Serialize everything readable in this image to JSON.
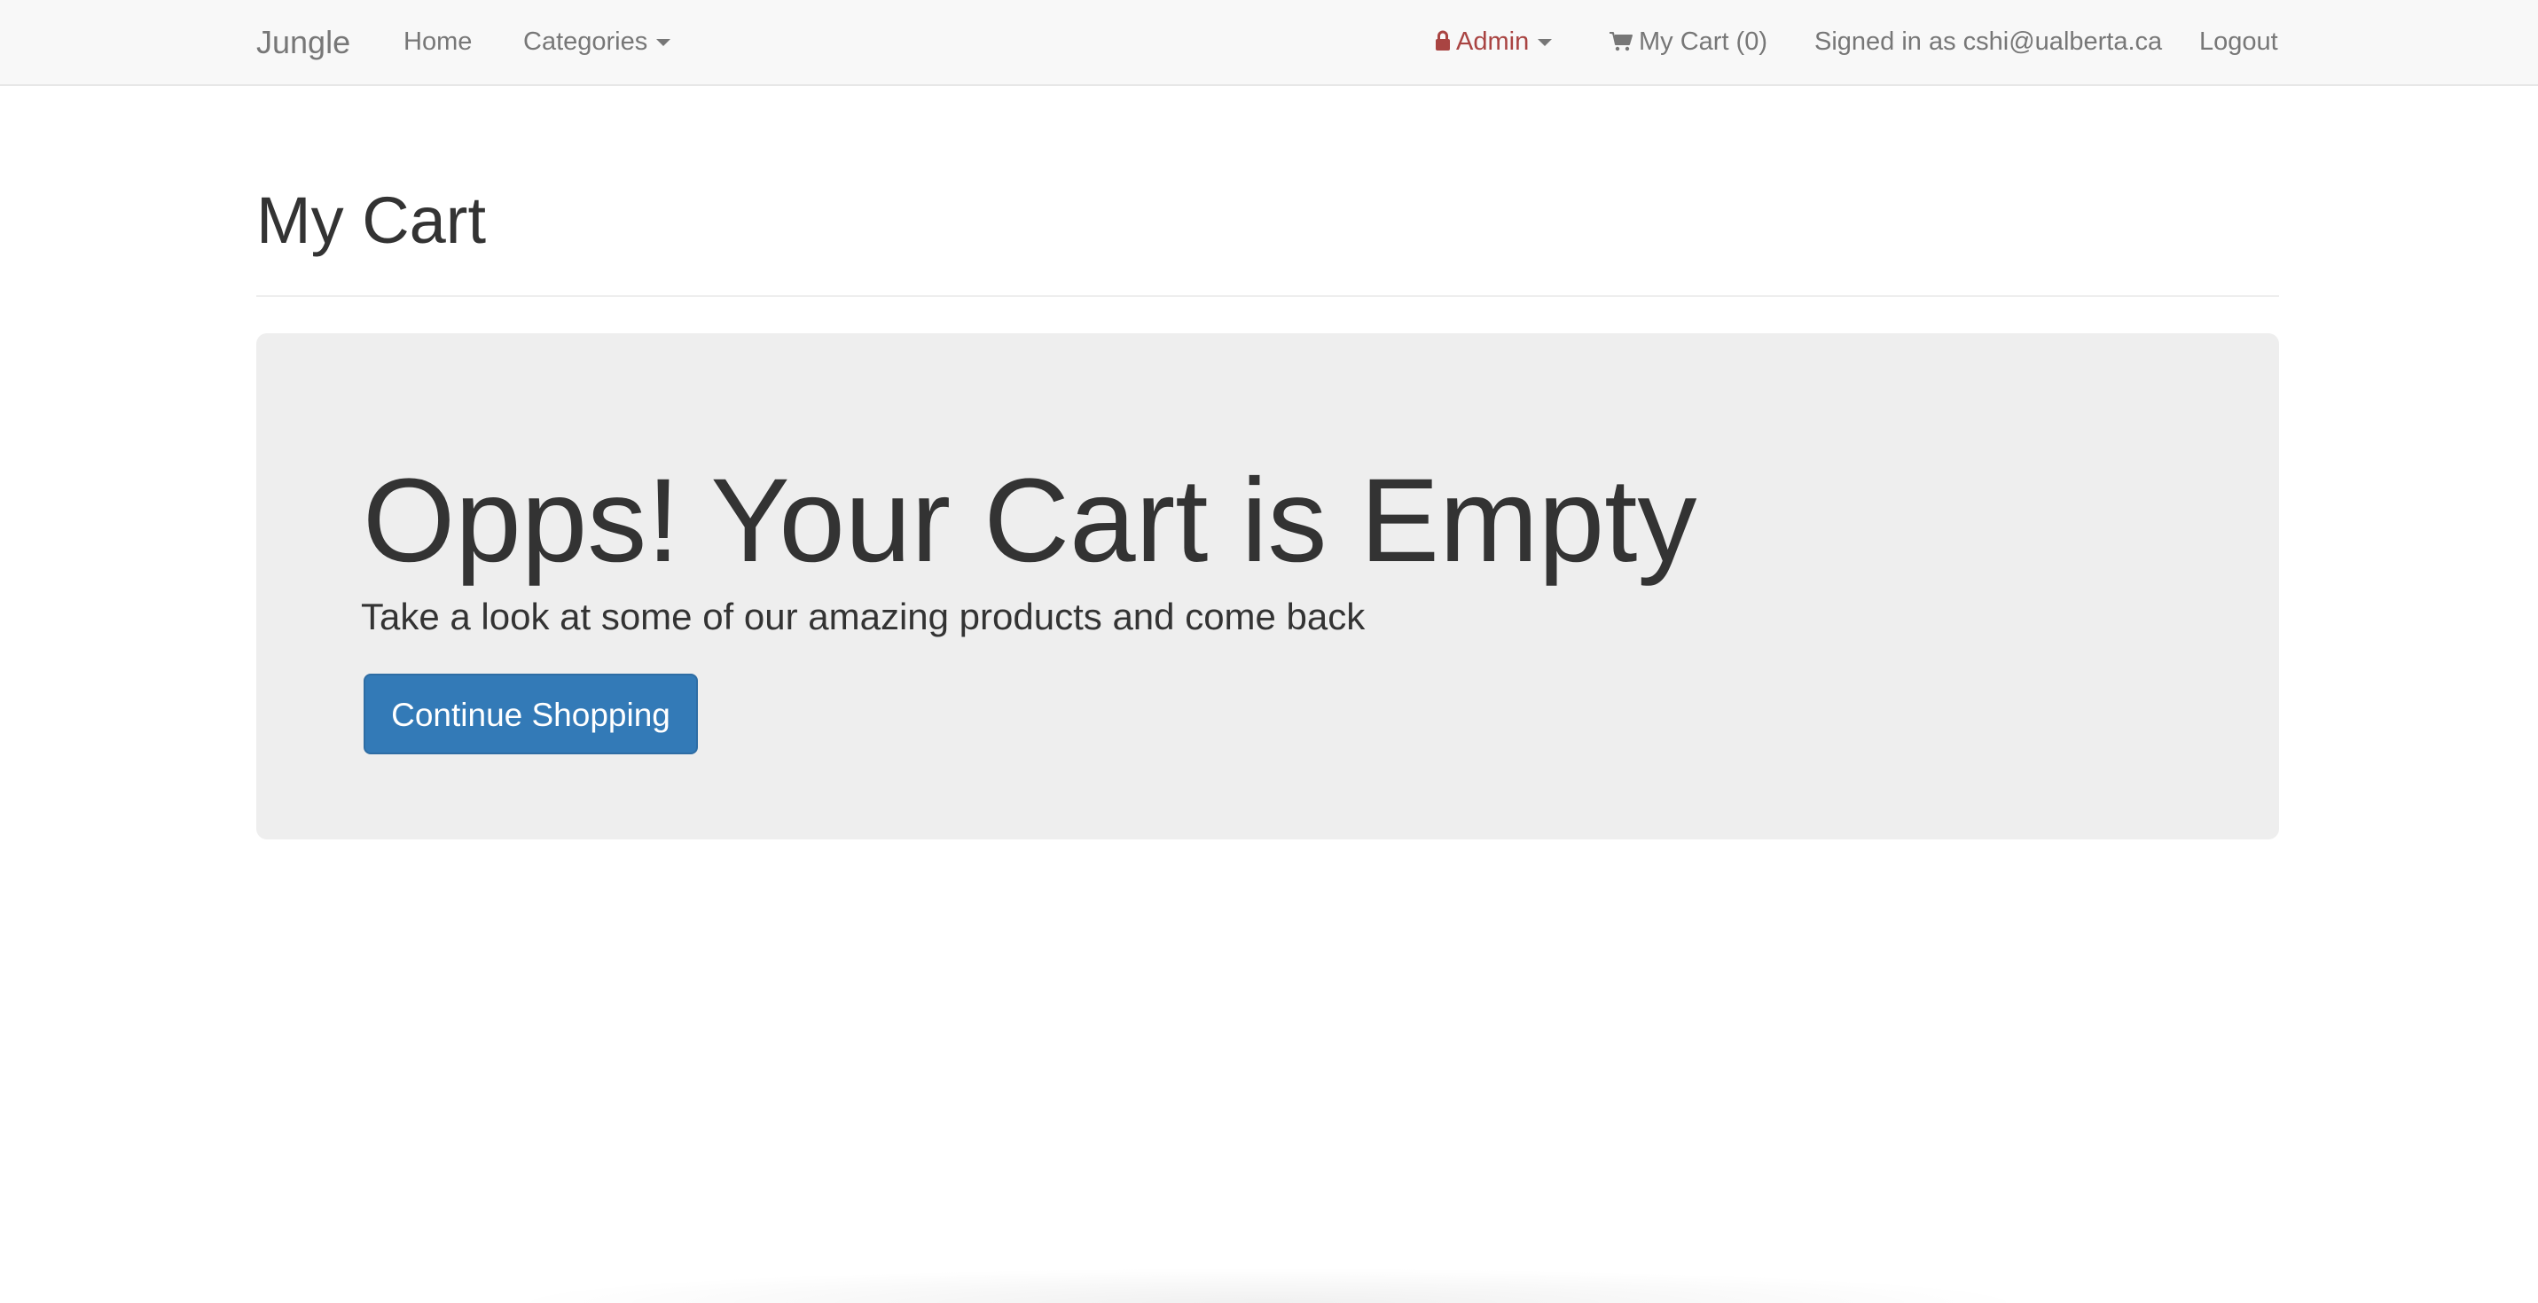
{
  "navbar": {
    "brand": "Jungle",
    "home": "Home",
    "categories": "Categories",
    "admin": "Admin",
    "cart": "My Cart (0)",
    "signed_in": "Signed in as cshi@ualberta.ca",
    "logout": "Logout",
    "admin_color": "#a94442"
  },
  "main": {
    "title": "My Cart",
    "empty_heading": "Opps! Your Cart is Empty",
    "empty_message": "Take a look at some of our amazing products and come back",
    "continue_button": "Continue Shopping",
    "button_color": "#337ab7"
  },
  "icons": {
    "admin": "lock-icon",
    "cart": "shopping-cart-icon",
    "dropdown": "caret-down-icon"
  }
}
